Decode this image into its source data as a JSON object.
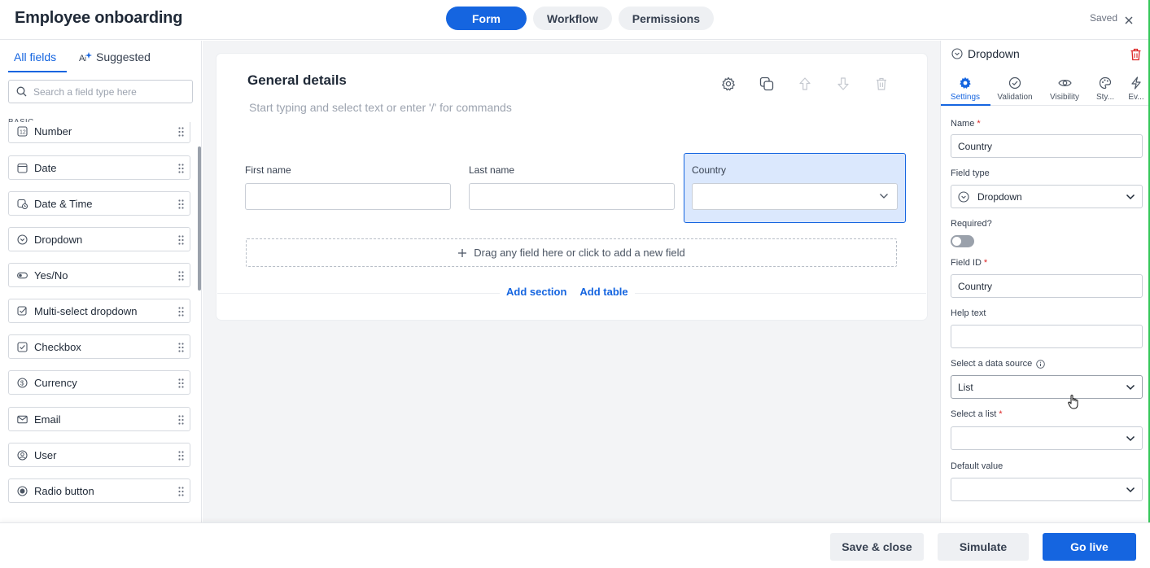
{
  "header": {
    "title": "Employee onboarding",
    "tabs": [
      "Form",
      "Workflow",
      "Permissions"
    ],
    "active_tab": "Form",
    "status": "Saved"
  },
  "palette": {
    "tabs": [
      "All fields",
      "Suggested"
    ],
    "search_placeholder": "Search a field type here",
    "group_label": "BASIC",
    "items": [
      {
        "label": "Number",
        "icon": "number-icon"
      },
      {
        "label": "Date",
        "icon": "calendar-icon"
      },
      {
        "label": "Date & Time",
        "icon": "datetime-icon"
      },
      {
        "label": "Dropdown",
        "icon": "dropdown-icon"
      },
      {
        "label": "Yes/No",
        "icon": "toggle-icon"
      },
      {
        "label": "Multi-select dropdown",
        "icon": "multiselect-icon"
      },
      {
        "label": "Checkbox",
        "icon": "checkbox-icon"
      },
      {
        "label": "Currency",
        "icon": "currency-icon"
      },
      {
        "label": "Email",
        "icon": "email-icon"
      },
      {
        "label": "User",
        "icon": "user-icon"
      },
      {
        "label": "Radio button",
        "icon": "radio-icon"
      }
    ]
  },
  "section": {
    "title": "General details",
    "description_placeholder": "Start typing and select text or enter '/' for commands",
    "fields": [
      {
        "label": "First name",
        "value": ""
      },
      {
        "label": "Last name",
        "value": ""
      },
      {
        "label": "Country",
        "value": ""
      }
    ],
    "dropzone_text": "Drag any field here or click to add a new field",
    "add_section": "Add section",
    "add_table": "Add table"
  },
  "properties": {
    "title": "Dropdown",
    "tabs": [
      "Settings",
      "Validation",
      "Visibility",
      "Sty...",
      "Ev..."
    ],
    "active_tab": "Settings",
    "name_label": "Name",
    "name_value": "Country",
    "field_type_label": "Field type",
    "field_type_value": "Dropdown",
    "required_label": "Required?",
    "required_on": false,
    "field_id_label": "Field ID",
    "field_id_value": "Country",
    "help_text_label": "Help text",
    "help_text_value": "",
    "data_source_label": "Select a data source",
    "data_source_value": "List",
    "list_label": "Select a list",
    "list_value": "",
    "default_label": "Default value",
    "default_value": ""
  },
  "footer": {
    "save_close": "Save & close",
    "simulate": "Simulate",
    "go_live": "Go live"
  },
  "colors": {
    "accent": "#1565e0",
    "selected_field_bg": "#dbe8fd",
    "required": "#dc2626",
    "delete": "#dc2626"
  }
}
